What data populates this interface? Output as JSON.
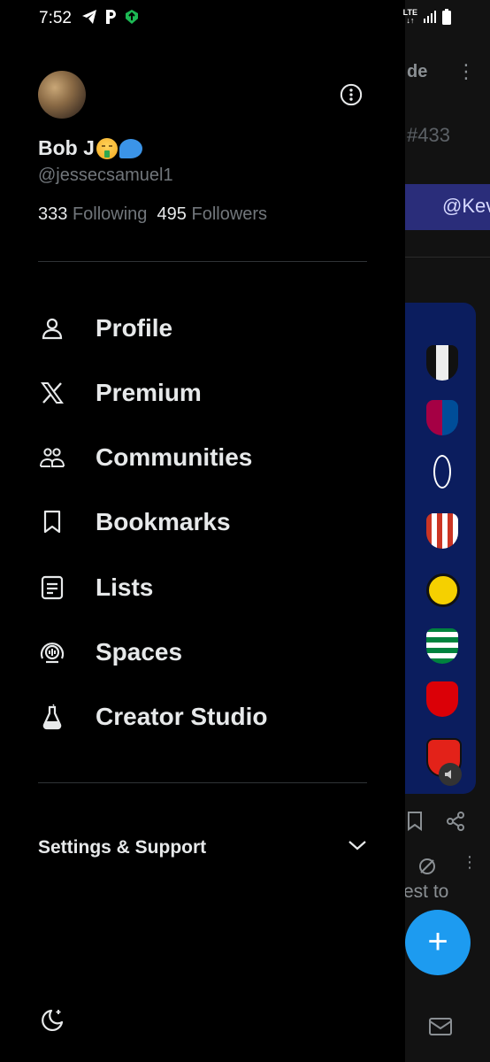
{
  "status_bar": {
    "time": "7:52",
    "network": "LTE"
  },
  "profile": {
    "name": "Bob J",
    "handle": "@jessecsamuel1",
    "following_count": "333",
    "following_label": "Following",
    "followers_count": "495",
    "followers_label": "Followers"
  },
  "menu": [
    {
      "label": "Profile",
      "icon": "person-icon"
    },
    {
      "label": "Premium",
      "icon": "x-logo-icon"
    },
    {
      "label": "Communities",
      "icon": "communities-icon"
    },
    {
      "label": "Bookmarks",
      "icon": "bookmark-icon"
    },
    {
      "label": "Lists",
      "icon": "list-icon"
    },
    {
      "label": "Spaces",
      "icon": "spaces-icon"
    },
    {
      "label": "Creator Studio",
      "icon": "flask-icon"
    }
  ],
  "settings_label": "Settings & Support",
  "background_feed": {
    "header_fragment": "de",
    "hashtag_fragment": "#433",
    "mention_fragment": "@Kev",
    "text_fragment": "est to"
  },
  "colors": {
    "accent": "#1d9bf0",
    "background": "#000000",
    "muted": "#71767b"
  }
}
